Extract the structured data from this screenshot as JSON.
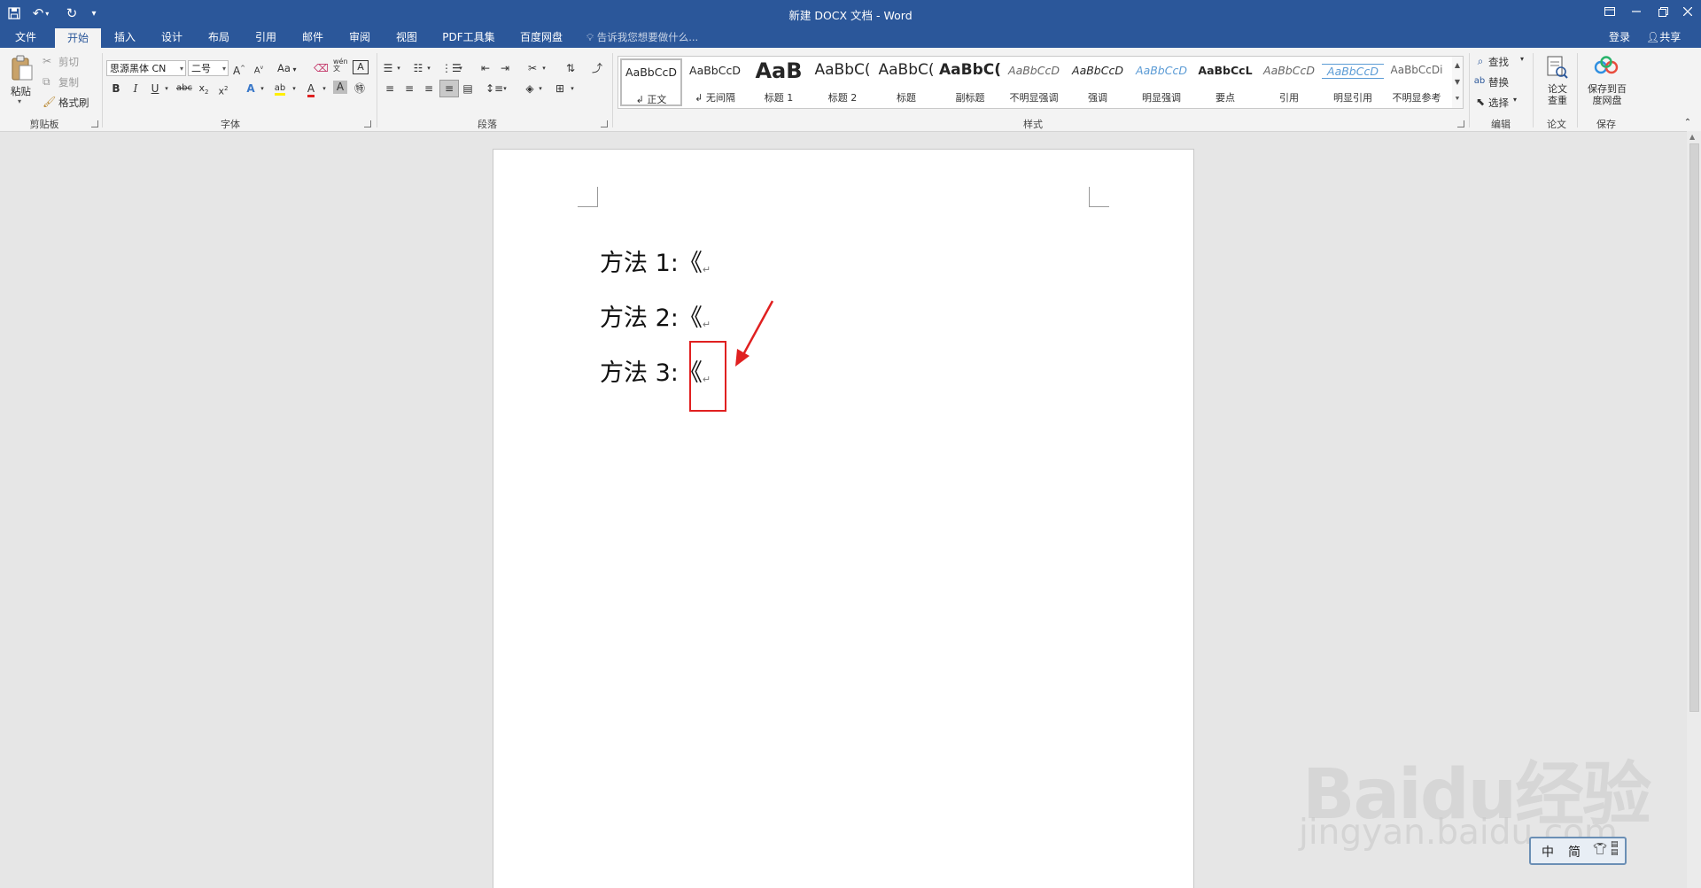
{
  "app": {
    "title": "新建 DOCX 文档 - Word",
    "accent_color": "#2b579a",
    "qat_icons": [
      "save-icon",
      "undo-icon",
      "redo-icon",
      "customize-icon"
    ]
  },
  "tabs": [
    {
      "label": "文件"
    },
    {
      "label": "开始",
      "active": true
    },
    {
      "label": "插入"
    },
    {
      "label": "设计"
    },
    {
      "label": "布局"
    },
    {
      "label": "引用"
    },
    {
      "label": "邮件"
    },
    {
      "label": "审阅"
    },
    {
      "label": "视图"
    },
    {
      "label": "PDF工具集"
    },
    {
      "label": "百度网盘"
    }
  ],
  "tell_me_placeholder": "告诉我您想要做什么...",
  "account": {
    "login": "登录",
    "share": "共享"
  },
  "ribbon": {
    "clipboard": {
      "label": "剪贴板",
      "paste": "粘贴",
      "cut": "剪切",
      "copy": "复制",
      "format_painter": "格式刷"
    },
    "font": {
      "label": "字体",
      "font_name": "思源黑体 CN",
      "font_size": "二号",
      "change_case": "Aa",
      "phonetic": "wén"
    },
    "paragraph": {
      "label": "段落"
    },
    "styles": {
      "label": "样式",
      "items": [
        {
          "preview": "AaBbCcD",
          "name": "↲ 正文",
          "selected": true
        },
        {
          "preview": "AaBbCcD",
          "name": "↲ 无间隔"
        },
        {
          "preview": "AaB",
          "name": "标题 1"
        },
        {
          "preview": "AaBbC(",
          "name": "标题 2"
        },
        {
          "preview": "AaBbC(",
          "name": "标题"
        },
        {
          "preview": "AaBbC(",
          "name": "副标题"
        },
        {
          "preview": "AaBbCcD",
          "name": "不明显强调"
        },
        {
          "preview": "AaBbCcD",
          "name": "强调"
        },
        {
          "preview": "AaBbCcD",
          "name": "明显强调"
        },
        {
          "preview": "AaBbCcL",
          "name": "要点"
        },
        {
          "preview": "AaBbCcD",
          "name": "引用"
        },
        {
          "preview": "AaBbCcD",
          "name": "明显引用"
        },
        {
          "preview": "AaBbCcDi",
          "name": "不明显参考"
        }
      ]
    },
    "editing": {
      "label": "编辑",
      "find": "查找",
      "replace": "替换",
      "select": "选择"
    },
    "thesis": {
      "label": "论文",
      "check": "论文查重"
    },
    "save": {
      "label": "保存",
      "save_to_cloud": "保存到百度网盘"
    }
  },
  "document": {
    "lines": [
      {
        "text": "方法 1:",
        "symbol": "《"
      },
      {
        "text": "方法 2:",
        "symbol": "《"
      },
      {
        "text": "方法 3:",
        "symbol": "《"
      }
    ],
    "paragraph_mark": "↵"
  },
  "ime": {
    "mode": "中",
    "script": "简"
  },
  "watermark": {
    "logo": "Baidu经验",
    "url": "jingyan.baidu.com"
  }
}
